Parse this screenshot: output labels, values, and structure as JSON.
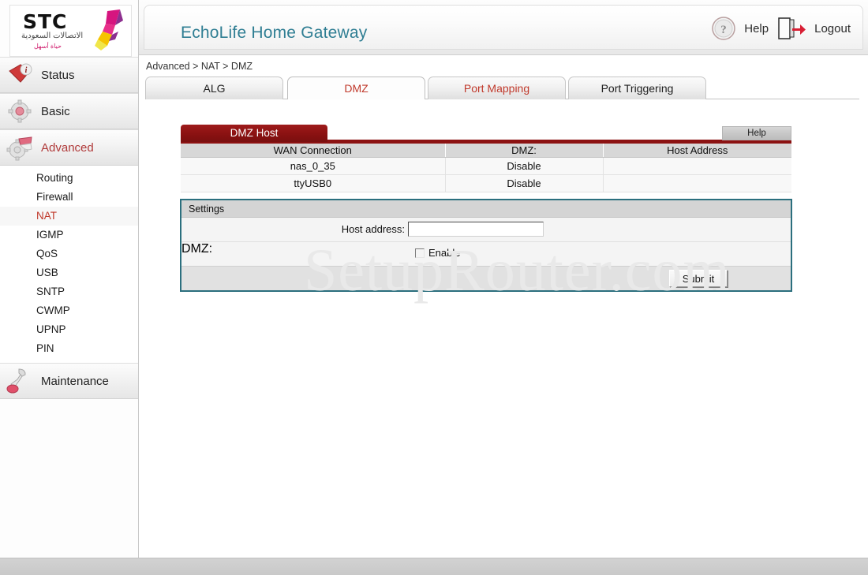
{
  "brand": {
    "logo_text": "STC",
    "logo_arabic_primary": "الاتصالات السعودية",
    "logo_arabic_tagline": "حياة أسهل",
    "logo_mark_icon": "stc-butterfly-icon"
  },
  "header": {
    "title": "EchoLife Home Gateway",
    "help_label": "Help",
    "help_icon": "question-circle-icon",
    "logout_label": "Logout",
    "logout_icon": "door-exit-arrow-icon"
  },
  "breadcrumb": "Advanced > NAT > DMZ",
  "tabs": [
    {
      "label": "ALG",
      "active": false,
      "hot": false
    },
    {
      "label": "DMZ",
      "active": true,
      "hot": false
    },
    {
      "label": "Port Mapping",
      "active": false,
      "hot": true
    },
    {
      "label": "Port Triggering",
      "active": false,
      "hot": false
    }
  ],
  "sidebar": {
    "groups": [
      {
        "label": "Status",
        "icon": "info-tag-icon",
        "active": false
      },
      {
        "label": "Basic",
        "icon": "gear-icon",
        "active": false
      },
      {
        "label": "Advanced",
        "icon": "gear-hand-icon",
        "active": true
      },
      {
        "label": "Maintenance",
        "icon": "wrench-icon",
        "active": false
      }
    ],
    "advanced_items": [
      {
        "label": "Routing",
        "active": false
      },
      {
        "label": "Firewall",
        "active": false
      },
      {
        "label": "NAT",
        "active": true
      },
      {
        "label": "IGMP",
        "active": false
      },
      {
        "label": "QoS",
        "active": false
      },
      {
        "label": "USB",
        "active": false
      },
      {
        "label": "SNTP",
        "active": false
      },
      {
        "label": "CWMP",
        "active": false
      },
      {
        "label": "UPNP",
        "active": false
      },
      {
        "label": "PIN",
        "active": false
      }
    ]
  },
  "panel": {
    "title": "DMZ Host",
    "help_label": "Help",
    "table": {
      "headers": [
        "WAN Connection",
        "DMZ:",
        "Host Address"
      ],
      "rows": [
        [
          "nas_0_35",
          "Disable",
          ""
        ],
        [
          "ttyUSB0",
          "Disable",
          ""
        ]
      ]
    }
  },
  "settings": {
    "title": "Settings",
    "host_address_label": "Host address:",
    "host_address_value": "",
    "host_address_placeholder": "",
    "dmz_label": "DMZ:",
    "dmz_enable_label": "Enable",
    "dmz_enabled": false,
    "submit_label": "Submit"
  },
  "watermark": "SetupRouter.com",
  "colors": {
    "title_teal": "#2f7e93",
    "accent_red": "#c0392b",
    "panel_dark_red": "#8c1212",
    "panel_border_teal": "#2b6f7e",
    "logo_magenta": "#cf1a6b"
  }
}
